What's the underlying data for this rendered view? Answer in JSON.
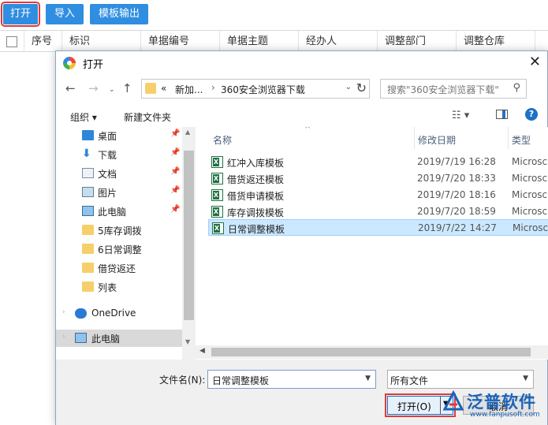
{
  "toolbar": {
    "open_label": "打开",
    "import_label": "导入",
    "export_label": "模板输出"
  },
  "grid": {
    "columns": [
      "序号",
      "标识",
      "单据编号",
      "单据主题",
      "经办人",
      "调整部门",
      "调整仓库"
    ]
  },
  "dialog": {
    "title": "打开",
    "address": {
      "overflow": "«",
      "segment1": "新加...",
      "segment2": "360安全浏览器下载"
    },
    "search_placeholder": "搜索\"360安全浏览器下载\"",
    "commands": {
      "organize": "组织 ▾",
      "new_folder": "新建文件夹"
    },
    "nav_items": [
      {
        "label": "桌面",
        "icon": "desktop-icon",
        "pinned": true
      },
      {
        "label": "下载",
        "icon": "download-icon",
        "pinned": true
      },
      {
        "label": "文档",
        "icon": "document-icon",
        "pinned": true
      },
      {
        "label": "图片",
        "icon": "picture-icon",
        "pinned": true
      },
      {
        "label": "此电脑",
        "icon": "computer-icon",
        "pinned": true
      },
      {
        "label": "5库存调拨",
        "icon": "folder-icon",
        "pinned": false
      },
      {
        "label": "6日常调整",
        "icon": "folder-icon",
        "pinned": false
      },
      {
        "label": "借贷返还",
        "icon": "folder-icon",
        "pinned": false
      },
      {
        "label": "列表",
        "icon": "folder-icon",
        "pinned": false
      },
      {
        "label": "OneDrive",
        "icon": "cloud-icon",
        "pinned": false
      },
      {
        "label": "此电脑",
        "icon": "computer-icon",
        "pinned": false
      }
    ],
    "columns": {
      "name": "名称",
      "modified": "修改日期",
      "type": "类型"
    },
    "files": [
      {
        "name": "红冲入库模板",
        "modified": "2019/7/19 16:28",
        "type": "Microsc"
      },
      {
        "name": "借货返还模板",
        "modified": "2019/7/20 18:33",
        "type": "Microsc"
      },
      {
        "name": "借货申请模板",
        "modified": "2019/7/20 18:16",
        "type": "Microsc"
      },
      {
        "name": "库存调拨模板",
        "modified": "2019/7/20 18:59",
        "type": "Microsc"
      },
      {
        "name": "日常调整模板",
        "modified": "2019/7/22 14:27",
        "type": "Microsc",
        "selected": true
      }
    ],
    "filename_label": "文件名(N):",
    "filename_value": "日常调整模板",
    "filetype_value": "所有文件",
    "open_button": "打开(O)",
    "cancel_button": "取消"
  },
  "logo": {
    "name": "泛普软件",
    "url": "www.fanpusoft.com"
  }
}
